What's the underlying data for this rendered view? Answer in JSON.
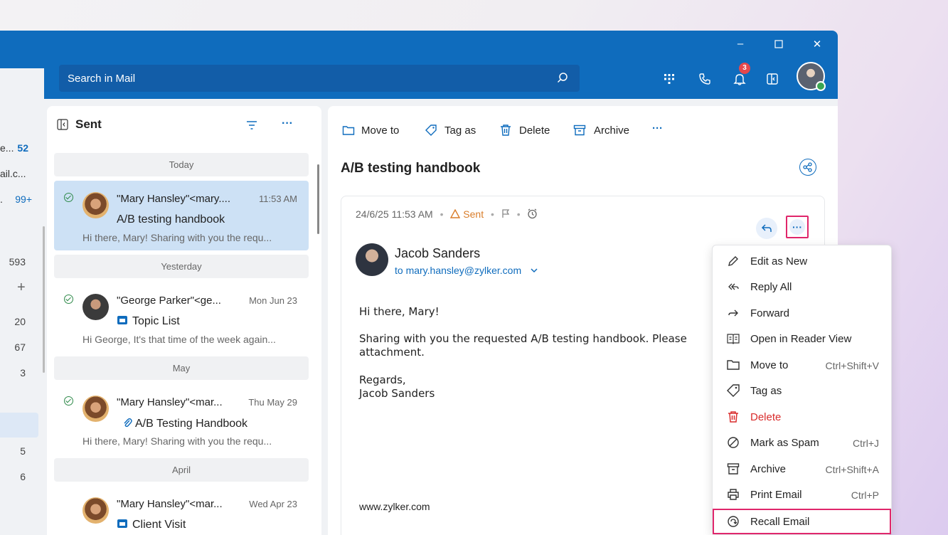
{
  "search": {
    "placeholder": "Search in Mail"
  },
  "notifications": {
    "count": "3"
  },
  "left_nav": {
    "rows": [
      {
        "label": "e...",
        "count": "52",
        "highlight": true
      },
      {
        "label": "ail.c...",
        "count": ""
      },
      {
        "label": ".",
        "count": "99+",
        "highlight": true
      },
      {
        "label": "",
        "count": "593"
      },
      {
        "label": "",
        "count": "20"
      },
      {
        "label": "",
        "count": "67"
      },
      {
        "label": "",
        "count": "3"
      },
      {
        "label": "",
        "count": "5"
      },
      {
        "label": "",
        "count": "6"
      }
    ],
    "plus": "+"
  },
  "list": {
    "title": "Sent",
    "groups": [
      "Today",
      "Yesterday",
      "May",
      "April"
    ],
    "items": [
      {
        "from": "\"Mary Hansley\"<mary....",
        "date": "11:53 AM",
        "subject": "A/B testing handbook",
        "preview": "Hi there, Mary! Sharing with you the requ..."
      },
      {
        "from": "\"George Parker\"<ge...",
        "date": "Mon Jun 23",
        "subject": "Topic List",
        "preview": "Hi George, It's that time of the week again..."
      },
      {
        "from": "\"Mary Hansley\"<mar...",
        "date": "Thu May 29",
        "subject": "A/B Testing Handbook",
        "preview": "Hi there, Mary! Sharing with you the requ..."
      },
      {
        "from": "\"Mary Hansley\"<mar...",
        "date": "Wed Apr 23",
        "subject": "Client Visit",
        "preview": ""
      }
    ]
  },
  "toolbar": {
    "move_to": "Move to",
    "tag_as": "Tag as",
    "delete": "Delete",
    "archive": "Archive",
    "more": "···"
  },
  "mail": {
    "title": "A/B testing handbook",
    "meta_date": "24/6/25 11:53 AM",
    "meta_status": "Sent",
    "sender": "Jacob Sanders",
    "to": "to mary.hansley@zylker.com",
    "greeting": "Hi there, Mary!",
    "body_line1": "Sharing with you the requested A/B testing handbook. Please",
    "body_line2": "attachment.",
    "regards": "Regards,",
    "signature": "Jacob Sanders",
    "footer": "www.zylker.com"
  },
  "menu": {
    "items": [
      {
        "label": "Edit as New",
        "shortcut": ""
      },
      {
        "label": "Reply All",
        "shortcut": ""
      },
      {
        "label": "Forward",
        "shortcut": ""
      },
      {
        "label": "Open in Reader View",
        "shortcut": ""
      },
      {
        "label": "Move to",
        "shortcut": "Ctrl+Shift+V"
      },
      {
        "label": "Tag as",
        "shortcut": ""
      },
      {
        "label": "Delete",
        "shortcut": ""
      },
      {
        "label": "Mark as Spam",
        "shortcut": "Ctrl+J"
      },
      {
        "label": "Archive",
        "shortcut": "Ctrl+Shift+A"
      },
      {
        "label": "Print Email",
        "shortcut": "Ctrl+P"
      },
      {
        "label": "Recall Email",
        "shortcut": ""
      }
    ]
  },
  "colors": {
    "accent": "#0f6cbd",
    "selected": "#cde1f5",
    "danger": "#d92c2c",
    "highlight_border": "#e0266b",
    "sent_status": "#d97d2a"
  }
}
